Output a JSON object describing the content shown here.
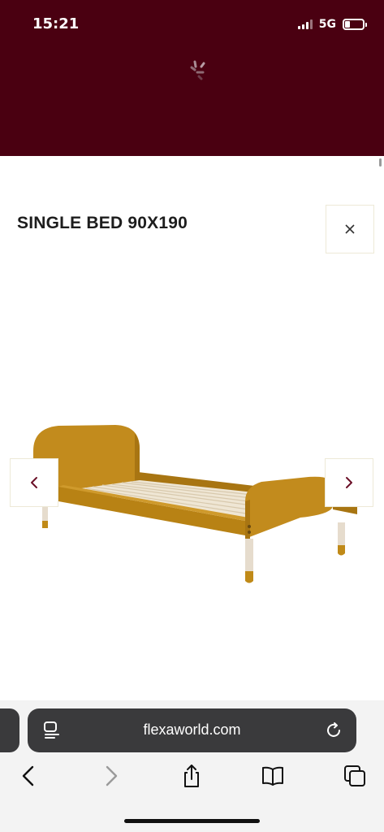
{
  "status_bar": {
    "time": "15:21",
    "network": "5G",
    "battery_level": 0.3,
    "signal_bars": 4,
    "signal_bars_active": 3
  },
  "modal": {
    "title": "SINGLE BED 90X190",
    "close_icon": "close-icon",
    "prev_icon": "chevron-left-icon",
    "next_icon": "chevron-right-icon",
    "accent_color": "#6b1027"
  },
  "product": {
    "image": "single-bed-mustard-image",
    "bed_color": "#c08a18"
  },
  "browser": {
    "url": "flexaworld.com",
    "page_menu_icon": "page-menu-icon",
    "reload_icon": "reload-icon"
  },
  "toolbar": {
    "back_icon": "back-icon",
    "forward_icon": "forward-icon",
    "share_icon": "share-icon",
    "bookmarks_icon": "bookmarks-icon",
    "tabs_icon": "tabs-icon"
  },
  "colors": {
    "header_bg": "#4a0011",
    "bar_bg": "#3a3a3c"
  }
}
